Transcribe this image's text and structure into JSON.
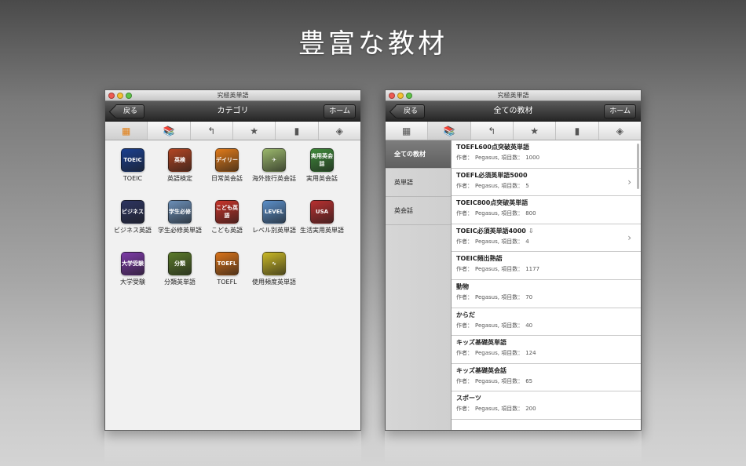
{
  "headline": "豊富な教材",
  "left_window": {
    "window_title": "究極英単語",
    "back_label": "戻る",
    "nav_title": "カテゴリ",
    "home_label": "ホーム",
    "toolbar": [
      {
        "icon": "grid-icon",
        "glyph": "▦",
        "active": true
      },
      {
        "icon": "books-icon",
        "glyph": "📚",
        "active": false
      },
      {
        "icon": "history-icon",
        "glyph": "↰",
        "active": false
      },
      {
        "icon": "star-icon",
        "glyph": "★",
        "active": false
      },
      {
        "icon": "notebook-icon",
        "glyph": "▮",
        "active": false
      },
      {
        "icon": "box-icon",
        "glyph": "◈",
        "active": false
      }
    ],
    "categories": [
      {
        "label": "TOEIC",
        "icon_text": "TOEIC",
        "color": "#1a3f8f",
        "icon": "toeic-icon"
      },
      {
        "label": "英語検定",
        "icon_text": "英検",
        "color": "#b34522",
        "icon": "eiken-icon"
      },
      {
        "label": "日常英会話",
        "icon_text": "デイリー",
        "color": "#e07a1a",
        "icon": "daily-conversation-icon"
      },
      {
        "label": "海外旅行英会話",
        "icon_text": "✈",
        "color": "#9bb86c",
        "icon": "travel-map-icon"
      },
      {
        "label": "実用英会話",
        "icon_text": "実用英会話",
        "color": "#3f8a3a",
        "icon": "pencils-icon"
      },
      {
        "label": "ビジネス英語",
        "icon_text": "ビジネス",
        "color": "#2d3561",
        "icon": "business-icon"
      },
      {
        "label": "学生必修英単語",
        "icon_text": "学生必修",
        "color": "#6b8fb8",
        "icon": "student-icon"
      },
      {
        "label": "こども英語",
        "icon_text": "こども英語",
        "color": "#c8342a",
        "icon": "kids-icon"
      },
      {
        "label": "レベル別英単語",
        "icon_text": "LEVEL",
        "color": "#5b8fc9",
        "icon": "level-icon"
      },
      {
        "label": "生活実用英単語",
        "icon_text": "USA",
        "color": "#b83030",
        "icon": "usa-flag-icon"
      },
      {
        "label": "大学受験",
        "icon_text": "大学受験",
        "color": "#7d3aa8",
        "icon": "university-icon"
      },
      {
        "label": "分類英単語",
        "icon_text": "分類",
        "color": "#5a7a2a",
        "icon": "classification-icon"
      },
      {
        "label": "TOEFL",
        "icon_text": "TOEFL",
        "color": "#d9731a",
        "icon": "toefl-icon"
      },
      {
        "label": "使用頻度英単語",
        "icon_text": "∿",
        "color": "#c9b826",
        "icon": "frequency-icon"
      }
    ]
  },
  "right_window": {
    "window_title": "究極英単語",
    "back_label": "戻る",
    "nav_title": "全ての教材",
    "home_label": "ホーム",
    "toolbar": [
      {
        "icon": "grid-icon",
        "glyph": "▦",
        "active": false
      },
      {
        "icon": "books-icon",
        "glyph": "📚",
        "active": true
      },
      {
        "icon": "history-icon",
        "glyph": "↰",
        "active": false
      },
      {
        "icon": "star-icon",
        "glyph": "★",
        "active": false
      },
      {
        "icon": "notebook-icon",
        "glyph": "▮",
        "active": false
      },
      {
        "icon": "box-icon",
        "glyph": "◈",
        "active": false
      }
    ],
    "sidebar": [
      {
        "label": "全ての教材",
        "selected": true
      },
      {
        "label": "英単語",
        "selected": false
      },
      {
        "label": "英会話",
        "selected": false
      }
    ],
    "author_prefix": "作者：",
    "count_prefix": "項目数：",
    "materials": [
      {
        "title": "TOEFL600点突破英単語",
        "author": "Pegasus",
        "count": "1000",
        "chevron": false,
        "download": false
      },
      {
        "title": "TOEFL必須英単語5000",
        "author": "Pegasus",
        "count": "5",
        "chevron": true,
        "download": false
      },
      {
        "title": "TOEIC800点突破英単語",
        "author": "Pegasus",
        "count": "800",
        "chevron": false,
        "download": false
      },
      {
        "title": "TOEIC必須英単語4000",
        "author": "Pegasus",
        "count": "4",
        "chevron": true,
        "download": true
      },
      {
        "title": "TOEIC頻出熟語",
        "author": "Pegasus",
        "count": "1177",
        "chevron": false,
        "download": false
      },
      {
        "title": "動物",
        "author": "Pegasus",
        "count": "70",
        "chevron": false,
        "download": false
      },
      {
        "title": "からだ",
        "author": "Pegasus",
        "count": "40",
        "chevron": false,
        "download": false
      },
      {
        "title": "キッズ基礎英単語",
        "author": "Pegasus",
        "count": "124",
        "chevron": false,
        "download": false
      },
      {
        "title": "キッズ基礎英会話",
        "author": "Pegasus",
        "count": "65",
        "chevron": false,
        "download": false
      },
      {
        "title": "スポーツ",
        "author": "Pegasus",
        "count": "200",
        "chevron": false,
        "download": false
      }
    ]
  }
}
